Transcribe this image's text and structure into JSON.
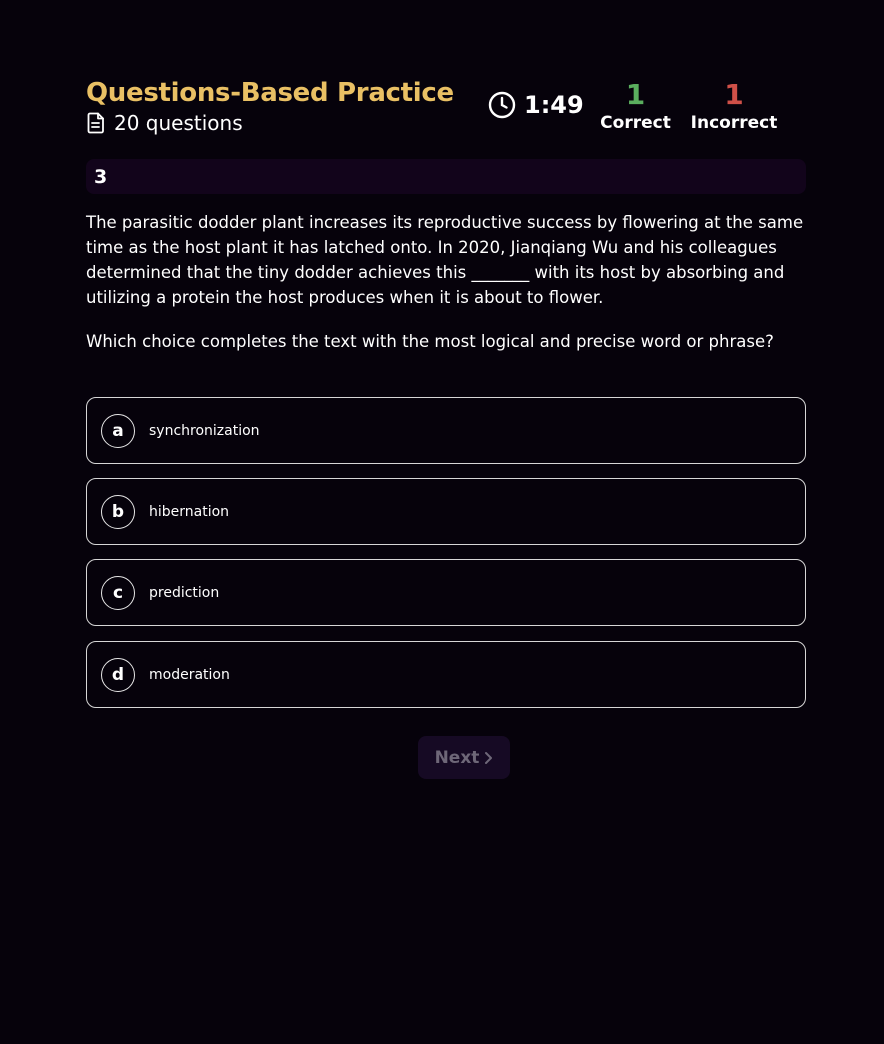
{
  "header": {
    "title": "Questions-Based Practice",
    "question_count": "20 questions",
    "timer": "1:49",
    "correct": {
      "value": "1",
      "label": "Correct"
    },
    "incorrect": {
      "value": "1",
      "label": "Incorrect"
    }
  },
  "question": {
    "number": "3",
    "passage": "The parasitic dodder plant increases its reproductive success by flowering at the same time as the host plant it has latched onto. In 2020, Jianqiang Wu and his colleagues determined that the tiny dodder achieves this _______ with its host by absorbing and utilizing a protein the host produces when it is about to flower.",
    "prompt": "Which choice completes the text with the most logical and precise word or phrase?",
    "choices": [
      {
        "letter": "a",
        "text": "synchronization"
      },
      {
        "letter": "b",
        "text": "hibernation"
      },
      {
        "letter": "c",
        "text": "prediction"
      },
      {
        "letter": "d",
        "text": "moderation"
      }
    ]
  },
  "navigation": {
    "next_label": "Next"
  },
  "colors": {
    "background": "#06020b",
    "title": "#e9c064",
    "correct": "#5aae5e",
    "incorrect": "#cf5048",
    "question_bar": "#12041b",
    "next_button_bg": "#160a24",
    "next_button_text": "#6e6778"
  },
  "icons": {
    "question_count": "document-icon",
    "timer": "clock-icon",
    "next": "chevron-right-icon"
  }
}
